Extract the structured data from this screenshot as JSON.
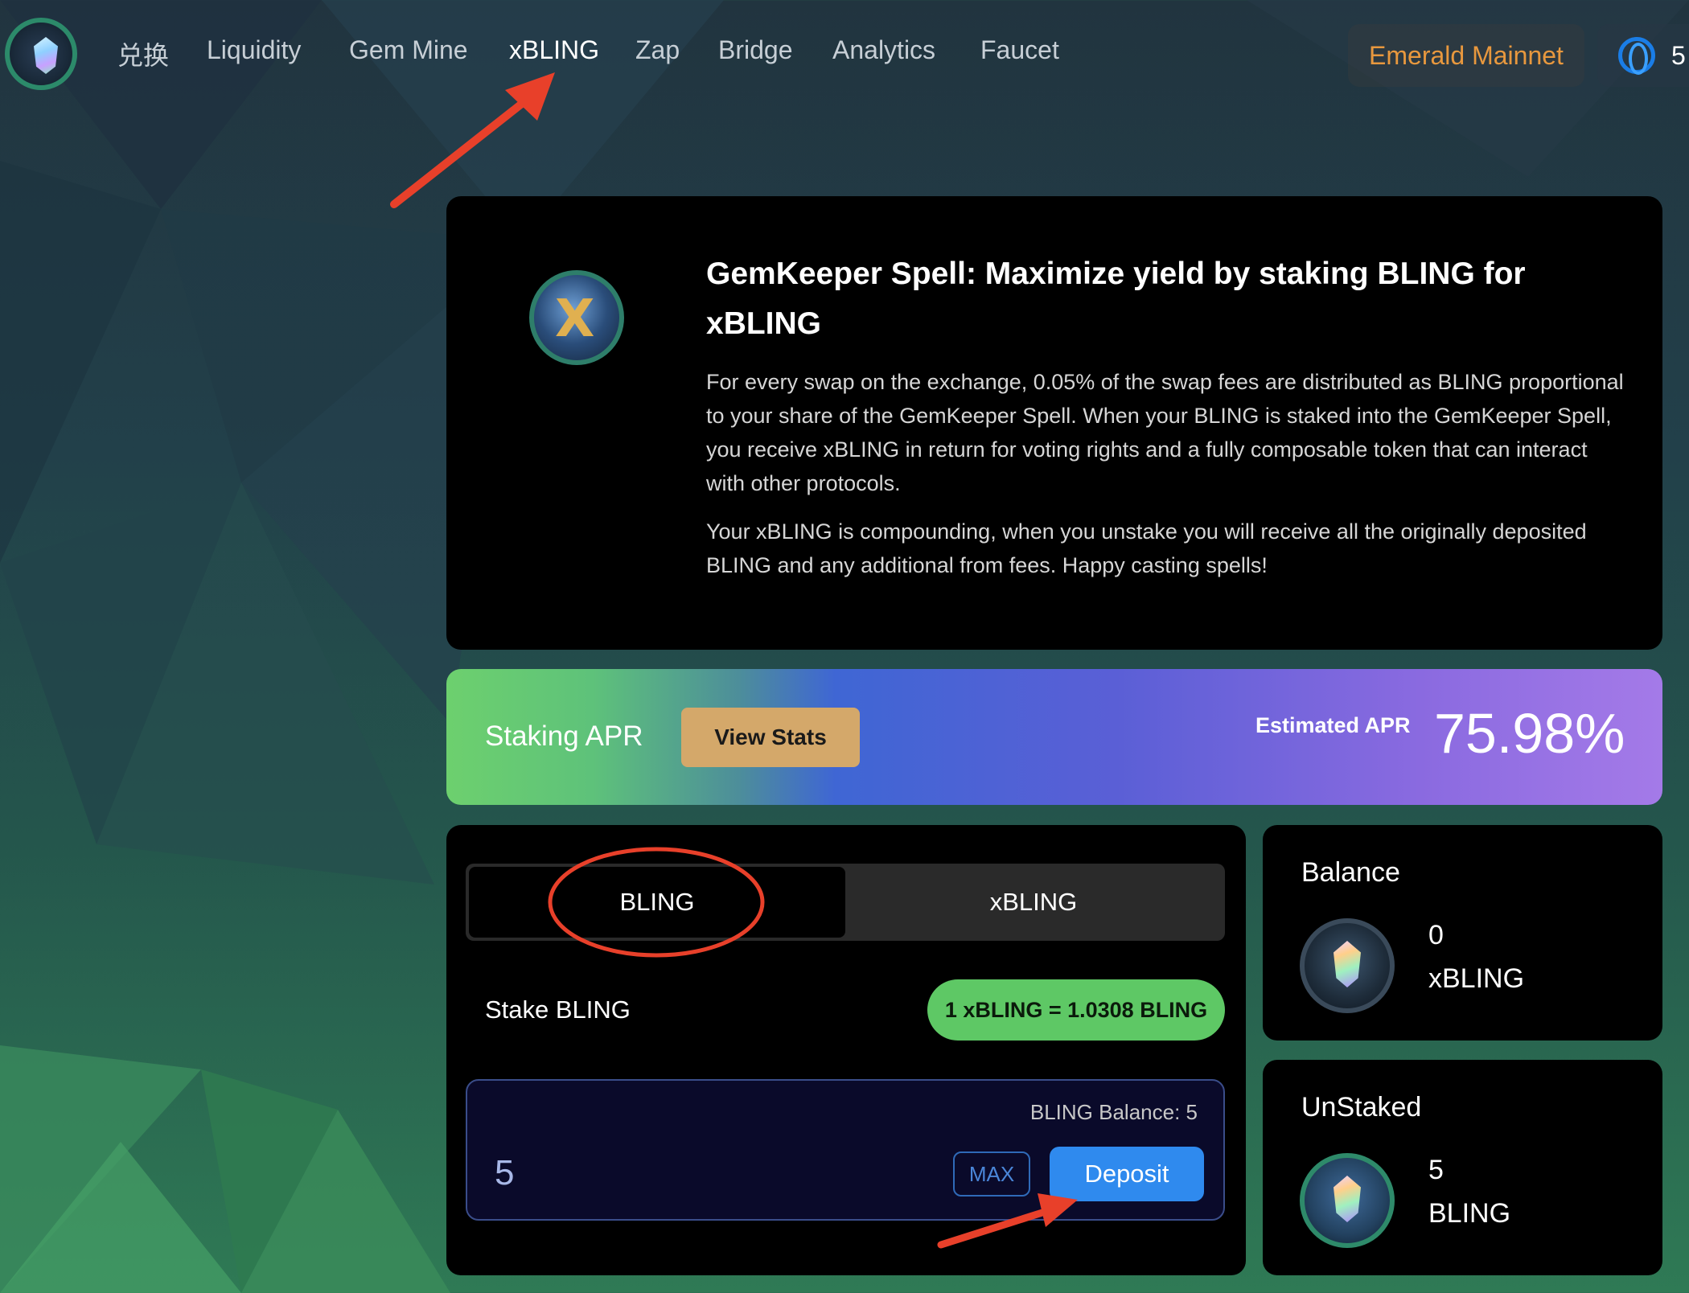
{
  "nav": {
    "items": [
      {
        "label": "兑换"
      },
      {
        "label": "Liquidity"
      },
      {
        "label": "Gem Mine"
      },
      {
        "label": "xBLING"
      },
      {
        "label": "Zap"
      },
      {
        "label": "Bridge"
      },
      {
        "label": "Analytics"
      },
      {
        "label": "Faucet"
      }
    ],
    "active": "xBLING",
    "network": "Emerald Mainnet",
    "wallet_partial": "5"
  },
  "hero": {
    "title": "GemKeeper Spell: Maximize yield by staking BLING for xBLING",
    "paragraph1": "For every swap on the exchange, 0.05% of the swap fees are distributed as BLING proportional to your share of the GemKeeper Spell. When your BLING is staked into the GemKeeper Spell, you receive xBLING in return for voting rights and a fully composable token that can interact with other protocols.",
    "paragraph2": "Your xBLING is compounding, when you unstake you will receive all the originally deposited BLING and any additional from fees. Happy casting spells!"
  },
  "apr": {
    "label": "Staking APR",
    "view_stats": "View Stats",
    "estimated_label": "Estimated APR",
    "estimated_value": "75.98%"
  },
  "stake": {
    "tabs": [
      "BLING",
      "xBLING"
    ],
    "selected_tab": "BLING",
    "label": "Stake BLING",
    "rate": "1 xBLING = 1.0308 BLING",
    "balance_label": "BLING Balance: 5",
    "amount_value": "5",
    "max_label": "MAX",
    "deposit_label": "Deposit"
  },
  "balance_card": {
    "title": "Balance",
    "value": "0",
    "unit": "xBLING"
  },
  "unstaked_card": {
    "title": "UnStaked",
    "value": "5",
    "unit": "BLING"
  },
  "colors": {
    "network_text": "#e8983e",
    "view_stats_bg": "#d4a86a",
    "rate_badge_bg": "#5ec865",
    "deposit_bg": "#2f8aee",
    "annotation_red": "#e8402a"
  }
}
